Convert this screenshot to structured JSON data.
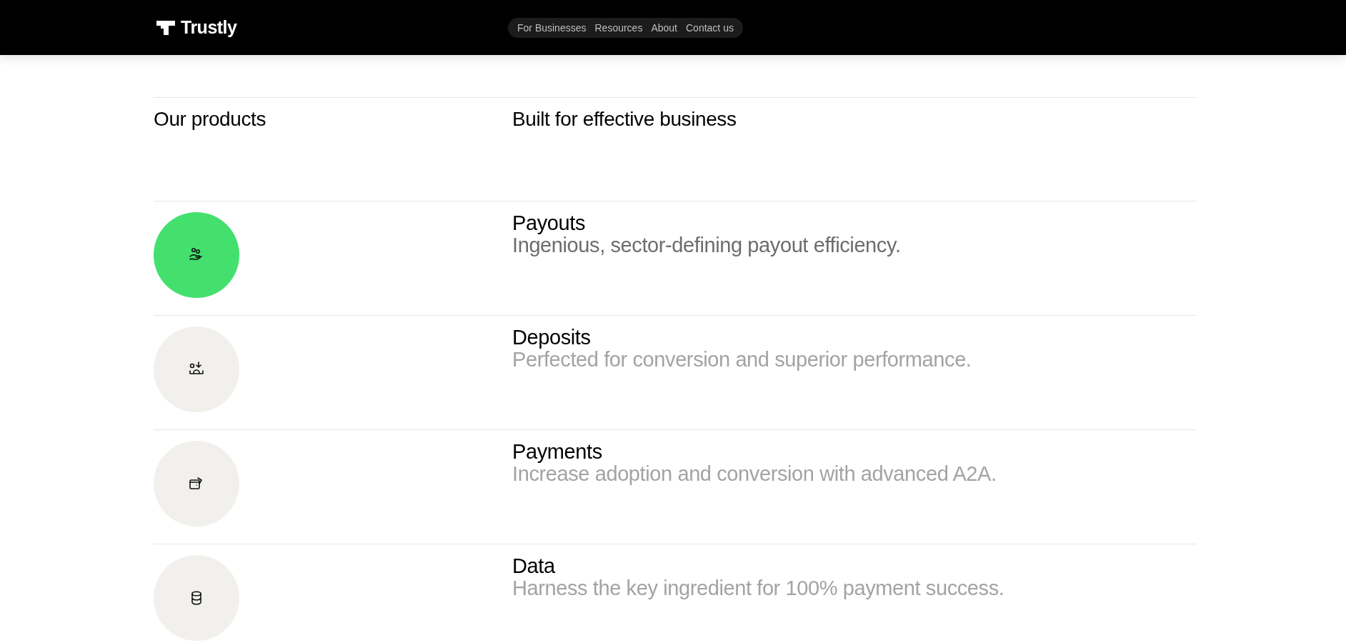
{
  "header": {
    "logo": "Trustly",
    "nav": [
      "For Businesses",
      "Resources",
      "About",
      "Contact us"
    ]
  },
  "section": {
    "label": "Our products",
    "heading": "Built for effective business"
  },
  "products": [
    {
      "kind": "payouts",
      "title": "Payouts",
      "description": "Ingenious, sector-defining payout efficiency.",
      "selected": true
    },
    {
      "kind": "deposits",
      "title": "Deposits",
      "description": "Perfected for conversion and superior performance.",
      "selected": false
    },
    {
      "kind": "payments",
      "title": "Payments",
      "description": "Increase adoption and conversion with advanced A2A.",
      "selected": false
    },
    {
      "kind": "data",
      "title": "Data",
      "description": "Harness the key ingredient for 100% payment success.",
      "selected": false
    }
  ]
}
